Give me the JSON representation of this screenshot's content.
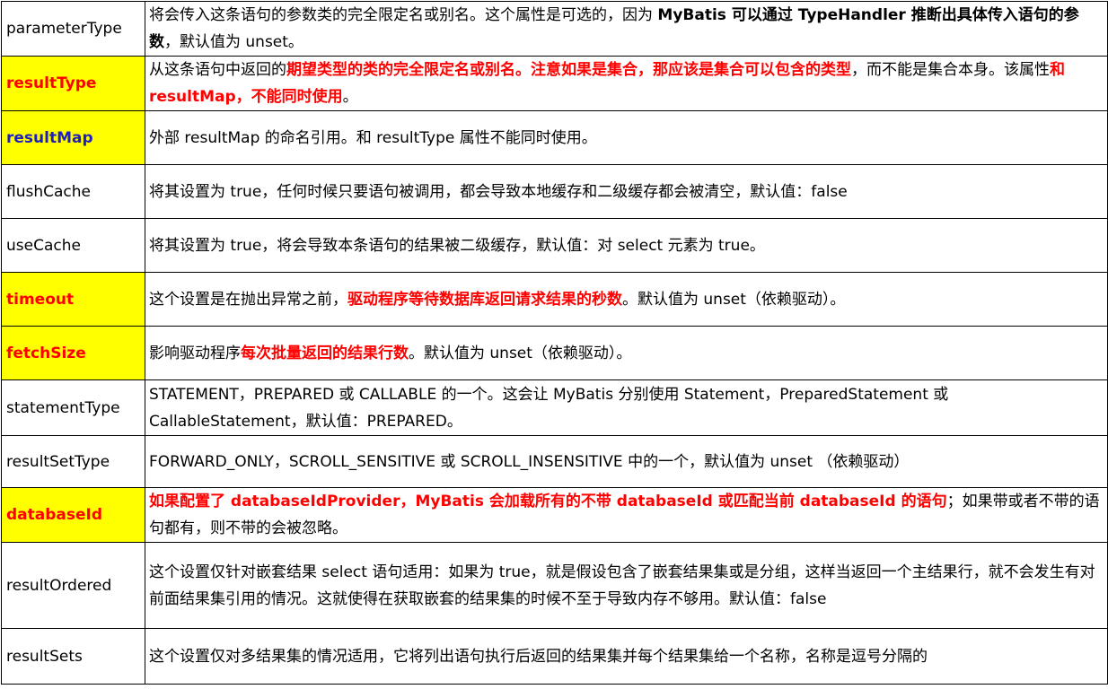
{
  "colors": {
    "highlight_bg": "#ffff00",
    "emphasis_red": "#ff0000",
    "emphasis_blue": "#1f1fbf",
    "border": "#000000"
  },
  "rows": [
    {
      "name": "parameterType",
      "name_style": "normal",
      "segments": [
        {
          "t": "将会传入这条语句的参数类的完全限定名或别名。这个属性是可选的，因为 ",
          "s": "normal"
        },
        {
          "t": "MyBatis 可以通过 TypeHandler 推断出具体传入语句的参数",
          "s": "bold"
        },
        {
          "t": "，默认值为 unset。",
          "s": "normal"
        }
      ]
    },
    {
      "name": "resultType",
      "name_style": "red",
      "segments": [
        {
          "t": "从这条语句中返回的",
          "s": "normal"
        },
        {
          "t": "期望类型的类的完全限定名或别名。注意如果是集合，那应该是集合可以包含的类型",
          "s": "red"
        },
        {
          "t": "，而不能是集合本身。该属性",
          "s": "normal"
        },
        {
          "t": "和 resultMap，不能同时使用",
          "s": "red"
        },
        {
          "t": "。",
          "s": "normal"
        }
      ]
    },
    {
      "name": "resultMap",
      "name_style": "blue",
      "segments": [
        {
          "t": "外部 resultMap 的命名引用。和 resultType 属性不能同时使用。",
          "s": "normal"
        }
      ]
    },
    {
      "name": "flushCache",
      "name_style": "normal",
      "segments": [
        {
          "t": "将其设置为 true，任何时候只要语句被调用，都会导致本地缓存和二级缓存都会被清空，默认值：false",
          "s": "normal"
        }
      ]
    },
    {
      "name": "useCache",
      "name_style": "normal",
      "segments": [
        {
          "t": "将其设置为 true，将会导致本条语句的结果被二级缓存，默认值：对 select 元素为 true。",
          "s": "normal"
        }
      ]
    },
    {
      "name": "timeout",
      "name_style": "red",
      "segments": [
        {
          "t": "这个设置是在抛出异常之前，",
          "s": "normal"
        },
        {
          "t": "驱动程序等待数据库返回请求结果的秒数",
          "s": "red"
        },
        {
          "t": "。默认值为 unset（依赖驱动）。",
          "s": "normal"
        }
      ]
    },
    {
      "name": "fetchSize",
      "name_style": "red",
      "segments": [
        {
          "t": "影响驱动程序",
          "s": "normal"
        },
        {
          "t": "每次批量返回的结果行数",
          "s": "red"
        },
        {
          "t": "。默认值为 unset（依赖驱动）。",
          "s": "normal"
        }
      ]
    },
    {
      "name": "statementType",
      "name_style": "normal",
      "segments": [
        {
          "t": "STATEMENT，PREPARED 或 CALLABLE 的一个。这会让 MyBatis 分别使用 Statement，PreparedStatement 或 CallableStatement，默认值：PREPARED。",
          "s": "normal"
        }
      ]
    },
    {
      "name": "resultSetType",
      "name_style": "normal",
      "segments": [
        {
          "t": "FORWARD_ONLY，SCROLL_SENSITIVE 或 SCROLL_INSENSITIVE 中的一个，默认值为 unset （依赖驱动）",
          "s": "normal"
        }
      ]
    },
    {
      "name": "databaseId",
      "name_style": "red",
      "segments": [
        {
          "t": "如果配置了 databaseIdProvider，MyBatis 会加载所有的不带 databaseId 或匹配当前 databaseId 的语句",
          "s": "red"
        },
        {
          "t": "；如果带或者不带的语句都有，则不带的会被忽略。",
          "s": "normal"
        }
      ]
    },
    {
      "name": "resultOrdered",
      "name_style": "normal",
      "segments": [
        {
          "t": "这个设置仅针对嵌套结果 select 语句适用：如果为 true，就是假设包含了嵌套结果集或是分组，这样当返回一个主结果行，就不会发生有对前面结果集引用的情况。这就使得在获取嵌套的结果集的时候不至于导致内存不够用。默认值：false",
          "s": "normal"
        }
      ]
    },
    {
      "name": "resultSets",
      "name_style": "normal",
      "segments": [
        {
          "t": "这个设置仅对多结果集的情况适用，它将列出语句执行后返回的结果集并每个结果集给一个名称，名称是逗号分隔的",
          "s": "normal"
        }
      ]
    }
  ]
}
